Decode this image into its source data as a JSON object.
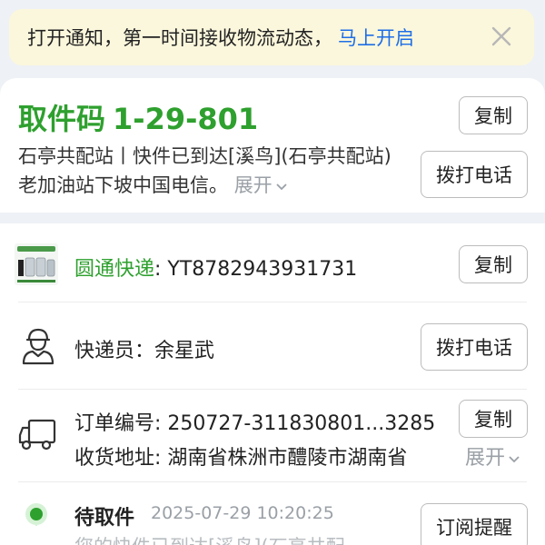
{
  "banner": {
    "text": "打开通知，第一时间接收物流动态，",
    "link": "马上开启"
  },
  "pickup": {
    "label": "取件码",
    "code": "1-29-801",
    "address_line": "石亭共配站丨快件已到达[溪鸟](石亭共配站)老加油站下坡中国电信。",
    "expand": "展开",
    "copy_button": "复制",
    "call_button": "拨打电话"
  },
  "express": {
    "company": "圆通快递",
    "tracking_number": ": YT8782943931731",
    "copy_button": "复制"
  },
  "courier": {
    "label": "快递员：余星武",
    "call_button": "拨打电话"
  },
  "order": {
    "order_label": "订单编号: 250727-311830801...3285",
    "address_label": "收货地址: 湖南省株洲市醴陵市湖南省",
    "copy_button": "复制",
    "expand": "展开"
  },
  "status": {
    "title": "待取件",
    "time": "2025-07-29 10:20:25",
    "detail": "您的快件已到达[溪鸟](石亭共配",
    "subscribe_button": "订阅提醒"
  },
  "colors": {
    "green": "#2ea02e",
    "link_blue": "#1e6ee6",
    "banner_bg": "#fbf7dc"
  }
}
